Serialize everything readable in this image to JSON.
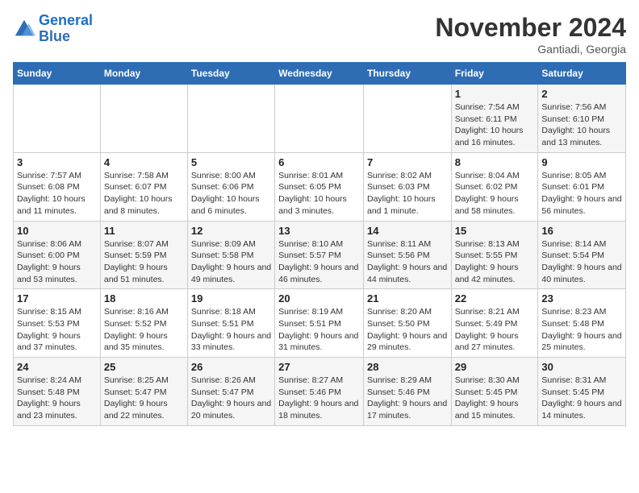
{
  "logo": {
    "text_general": "General",
    "text_blue": "Blue"
  },
  "header": {
    "month": "November 2024",
    "location": "Gantiadi, Georgia"
  },
  "days_of_week": [
    "Sunday",
    "Monday",
    "Tuesday",
    "Wednesday",
    "Thursday",
    "Friday",
    "Saturday"
  ],
  "weeks": [
    [
      {
        "day": "",
        "info": ""
      },
      {
        "day": "",
        "info": ""
      },
      {
        "day": "",
        "info": ""
      },
      {
        "day": "",
        "info": ""
      },
      {
        "day": "",
        "info": ""
      },
      {
        "day": "1",
        "info": "Sunrise: 7:54 AM\nSunset: 6:11 PM\nDaylight: 10 hours and 16 minutes."
      },
      {
        "day": "2",
        "info": "Sunrise: 7:56 AM\nSunset: 6:10 PM\nDaylight: 10 hours and 13 minutes."
      }
    ],
    [
      {
        "day": "3",
        "info": "Sunrise: 7:57 AM\nSunset: 6:08 PM\nDaylight: 10 hours and 11 minutes."
      },
      {
        "day": "4",
        "info": "Sunrise: 7:58 AM\nSunset: 6:07 PM\nDaylight: 10 hours and 8 minutes."
      },
      {
        "day": "5",
        "info": "Sunrise: 8:00 AM\nSunset: 6:06 PM\nDaylight: 10 hours and 6 minutes."
      },
      {
        "day": "6",
        "info": "Sunrise: 8:01 AM\nSunset: 6:05 PM\nDaylight: 10 hours and 3 minutes."
      },
      {
        "day": "7",
        "info": "Sunrise: 8:02 AM\nSunset: 6:03 PM\nDaylight: 10 hours and 1 minute."
      },
      {
        "day": "8",
        "info": "Sunrise: 8:04 AM\nSunset: 6:02 PM\nDaylight: 9 hours and 58 minutes."
      },
      {
        "day": "9",
        "info": "Sunrise: 8:05 AM\nSunset: 6:01 PM\nDaylight: 9 hours and 56 minutes."
      }
    ],
    [
      {
        "day": "10",
        "info": "Sunrise: 8:06 AM\nSunset: 6:00 PM\nDaylight: 9 hours and 53 minutes."
      },
      {
        "day": "11",
        "info": "Sunrise: 8:07 AM\nSunset: 5:59 PM\nDaylight: 9 hours and 51 minutes."
      },
      {
        "day": "12",
        "info": "Sunrise: 8:09 AM\nSunset: 5:58 PM\nDaylight: 9 hours and 49 minutes."
      },
      {
        "day": "13",
        "info": "Sunrise: 8:10 AM\nSunset: 5:57 PM\nDaylight: 9 hours and 46 minutes."
      },
      {
        "day": "14",
        "info": "Sunrise: 8:11 AM\nSunset: 5:56 PM\nDaylight: 9 hours and 44 minutes."
      },
      {
        "day": "15",
        "info": "Sunrise: 8:13 AM\nSunset: 5:55 PM\nDaylight: 9 hours and 42 minutes."
      },
      {
        "day": "16",
        "info": "Sunrise: 8:14 AM\nSunset: 5:54 PM\nDaylight: 9 hours and 40 minutes."
      }
    ],
    [
      {
        "day": "17",
        "info": "Sunrise: 8:15 AM\nSunset: 5:53 PM\nDaylight: 9 hours and 37 minutes."
      },
      {
        "day": "18",
        "info": "Sunrise: 8:16 AM\nSunset: 5:52 PM\nDaylight: 9 hours and 35 minutes."
      },
      {
        "day": "19",
        "info": "Sunrise: 8:18 AM\nSunset: 5:51 PM\nDaylight: 9 hours and 33 minutes."
      },
      {
        "day": "20",
        "info": "Sunrise: 8:19 AM\nSunset: 5:51 PM\nDaylight: 9 hours and 31 minutes."
      },
      {
        "day": "21",
        "info": "Sunrise: 8:20 AM\nSunset: 5:50 PM\nDaylight: 9 hours and 29 minutes."
      },
      {
        "day": "22",
        "info": "Sunrise: 8:21 AM\nSunset: 5:49 PM\nDaylight: 9 hours and 27 minutes."
      },
      {
        "day": "23",
        "info": "Sunrise: 8:23 AM\nSunset: 5:48 PM\nDaylight: 9 hours and 25 minutes."
      }
    ],
    [
      {
        "day": "24",
        "info": "Sunrise: 8:24 AM\nSunset: 5:48 PM\nDaylight: 9 hours and 23 minutes."
      },
      {
        "day": "25",
        "info": "Sunrise: 8:25 AM\nSunset: 5:47 PM\nDaylight: 9 hours and 22 minutes."
      },
      {
        "day": "26",
        "info": "Sunrise: 8:26 AM\nSunset: 5:47 PM\nDaylight: 9 hours and 20 minutes."
      },
      {
        "day": "27",
        "info": "Sunrise: 8:27 AM\nSunset: 5:46 PM\nDaylight: 9 hours and 18 minutes."
      },
      {
        "day": "28",
        "info": "Sunrise: 8:29 AM\nSunset: 5:46 PM\nDaylight: 9 hours and 17 minutes."
      },
      {
        "day": "29",
        "info": "Sunrise: 8:30 AM\nSunset: 5:45 PM\nDaylight: 9 hours and 15 minutes."
      },
      {
        "day": "30",
        "info": "Sunrise: 8:31 AM\nSunset: 5:45 PM\nDaylight: 9 hours and 14 minutes."
      }
    ]
  ]
}
